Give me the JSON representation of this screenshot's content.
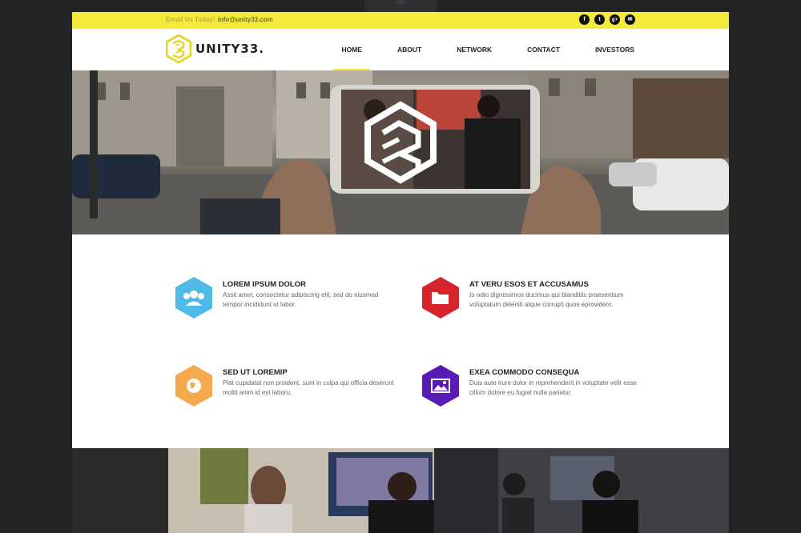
{
  "topbar": {
    "email_label": "Email Us Today!",
    "email_address": "info@unity33.com",
    "social": [
      {
        "icon": "facebook-icon",
        "glyph": "f"
      },
      {
        "icon": "twitter-icon",
        "glyph": "t"
      },
      {
        "icon": "google-plus-icon",
        "glyph": "g+"
      },
      {
        "icon": "email-icon",
        "glyph": "✉"
      }
    ]
  },
  "header": {
    "logo_text": "UNITY33.",
    "nav": [
      "HOME",
      "ABOUT",
      "NETWORK",
      "CONTACT",
      "INVESTORS"
    ],
    "active_nav": "HOME"
  },
  "features": [
    {
      "title": "LOREM IPSUM DOLOR",
      "description": "Assit amet, consectetur adipiscing elit, sed do eiusmod tempor incididunt ut labor.",
      "icon": "users-icon",
      "color": "#4fb9e8"
    },
    {
      "title": "AT VERU ESOS ET ACCUSAMUS",
      "description": "Io odio dignissimos ducimus qui blanditiis praesentium voluptatum deleniti atque corrupti quos eprovidero.",
      "icon": "folder-icon",
      "color": "#d6242c"
    },
    {
      "title": "SED UT LOREMIP",
      "description": "Plat cupidatat non proident, sunt in culpa qui officia deserunt mollit anim id est laboru.",
      "icon": "globe-icon",
      "color": "#f5a94d"
    },
    {
      "title": "EXEA COMMODO CONSEQUA",
      "description": "Duis aute irure dolor in reprehenderit in voluptate velit esse cillum dolore eu fugiat nulla pariatur.",
      "icon": "image-icon",
      "color": "#5a1ab6"
    }
  ],
  "colors": {
    "accent": "#f3ea3c",
    "page_background": "#232426"
  }
}
